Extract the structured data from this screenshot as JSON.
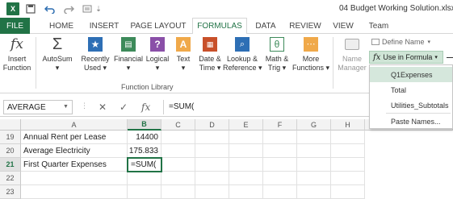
{
  "title_bar": {
    "document_title": "04 Budget Working Solution.xlsx - E",
    "app_logo": "X",
    "quick_access": [
      "save-icon",
      "undo-icon",
      "redo-icon",
      "customize-icon"
    ]
  },
  "tabs": [
    {
      "label": "FILE"
    },
    {
      "label": "HOME"
    },
    {
      "label": "INSERT"
    },
    {
      "label": "PAGE LAYOUT"
    },
    {
      "label": "FORMULAS"
    },
    {
      "label": "DATA"
    },
    {
      "label": "REVIEW"
    },
    {
      "label": "VIEW"
    },
    {
      "label": "Team"
    }
  ],
  "active_tab": "FORMULAS",
  "ribbon": {
    "insert_function": {
      "line1": "Insert",
      "line2": "Function",
      "icon": "fx-icon"
    },
    "autosum": {
      "line1": "AutoSum",
      "line2": "▾",
      "icon": "sigma-icon"
    },
    "recently_used": {
      "line1": "Recently",
      "line2": "Used ▾",
      "icon": "star-icon"
    },
    "financial": {
      "line1": "Financial",
      "line2": "▾",
      "icon": "financial-icon"
    },
    "logical": {
      "line1": "Logical",
      "line2": "▾",
      "icon": "question-icon"
    },
    "text": {
      "line1": "Text",
      "line2": "▾",
      "icon": "text-icon"
    },
    "date_time": {
      "line1": "Date &",
      "line2": "Time ▾",
      "icon": "calendar-icon"
    },
    "lookup_reference": {
      "line1": "Lookup &",
      "line2": "Reference ▾",
      "icon": "lookup-icon"
    },
    "math_trig": {
      "line1": "Math &",
      "line2": "Trig ▾",
      "icon": "theta-icon"
    },
    "more_functions": {
      "line1": "More",
      "line2": "Functions ▾",
      "icon": "more-icon"
    },
    "name_manager": {
      "line1": "Name",
      "line2": "Manager",
      "icon": "tag-icon"
    },
    "group_label": "Function Library",
    "define_name": "Define Name",
    "use_in_formula": "Use in Formula"
  },
  "use_in_formula_menu": {
    "items": [
      "Q1Expenses",
      "Total",
      "Utilities_Subtotals",
      "Paste Names..."
    ],
    "highlighted_index": 0
  },
  "formula_bar": {
    "name_box": "AVERAGE",
    "cancel_icon": "✕",
    "enter_icon": "✓",
    "fx_label": "fx",
    "formula": "=SUM("
  },
  "grid": {
    "columns": [
      "A",
      "B",
      "C",
      "D",
      "E",
      "F",
      "G",
      "H"
    ],
    "selected_column": "B",
    "rows": [
      {
        "num": "19",
        "a": "Annual Rent per Lease",
        "b": "14400"
      },
      {
        "num": "20",
        "a": "Average Electricity",
        "b": "175.833"
      },
      {
        "num": "21",
        "a": "First Quarter Expenses",
        "b": "=SUM("
      },
      {
        "num": "22",
        "a": "",
        "b": ""
      },
      {
        "num": "23",
        "a": "",
        "b": ""
      }
    ],
    "active_row": "21"
  },
  "colors": {
    "accent": "#217346",
    "highlight": "#d5e7dc"
  }
}
